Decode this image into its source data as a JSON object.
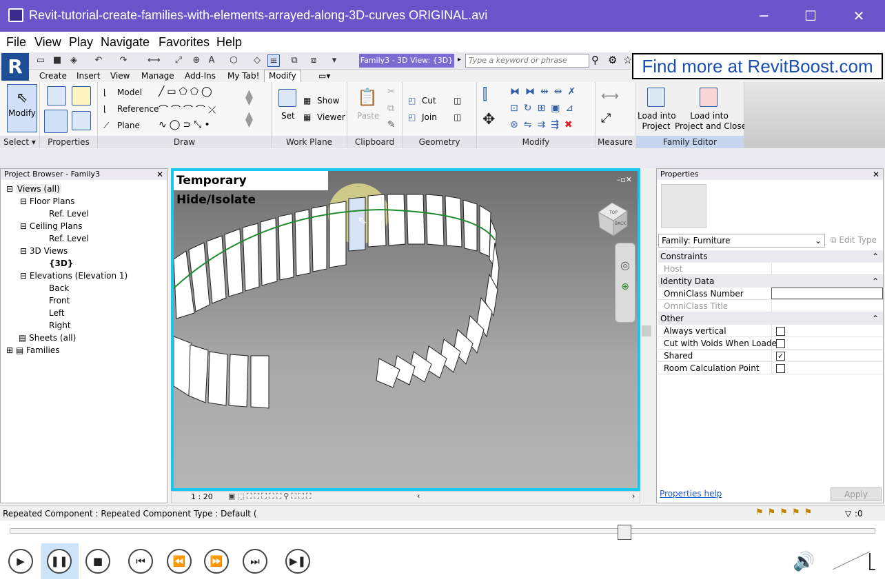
{
  "window": {
    "title": "Revit-tutorial-create-families-with-elements-arrayed-along-3D-curves ORIGINAL.avi",
    "minimize": "─",
    "maximize": "☐",
    "close": "✕"
  },
  "menu": [
    "File",
    "View",
    "Play",
    "Navigate",
    "Favorites",
    "Help"
  ],
  "revit": {
    "doc_title": "Family3 - 3D View: {3D}",
    "search_placeholder": "Type a keyword or phrase",
    "promo": "Find more at RevitBoost.com",
    "tabs": [
      "Create",
      "Insert",
      "View",
      "Manage",
      "Add-Ins",
      "My Tab!",
      "Modify"
    ],
    "active_tab": "Modify",
    "ribbon": {
      "modify_label": "Modify",
      "panels": [
        "Select ▾",
        "Properties",
        "Draw",
        "Work Plane",
        "Clipboard",
        "Geometry",
        "Modify",
        "Measure",
        "Family Editor"
      ],
      "draw_items": [
        "Model",
        "Reference",
        "Plane"
      ],
      "workplane_items": [
        "Set",
        "Show",
        "Viewer"
      ],
      "clipboard_paste": "Paste",
      "geometry_items": [
        "Cut",
        "Join"
      ],
      "family_editor": [
        "Load into\nProject",
        "Load into\nProject and Close"
      ]
    },
    "project_browser": {
      "title": "Project Browser - Family3",
      "items": [
        {
          "label": "Views (all)",
          "level": 0
        },
        {
          "label": "Floor Plans",
          "level": 1
        },
        {
          "label": "Ref. Level",
          "level": 2
        },
        {
          "label": "Ceiling Plans",
          "level": 1
        },
        {
          "label": "Ref. Level",
          "level": 2
        },
        {
          "label": "3D Views",
          "level": 1
        },
        {
          "label": "{3D}",
          "level": 2
        },
        {
          "label": "Elevations (Elevation 1)",
          "level": 1
        },
        {
          "label": "Back",
          "level": 2
        },
        {
          "label": "Front",
          "level": 2
        },
        {
          "label": "Left",
          "level": 2
        },
        {
          "label": "Right",
          "level": 2
        },
        {
          "label": "Sheets (all)",
          "level": 0
        },
        {
          "label": "Families",
          "level": 0
        }
      ]
    },
    "view": {
      "label": "Temporary Hide/Isolate",
      "scale": "1 : 20",
      "viewcube_top": "TOP",
      "viewcube_back": "BACK"
    },
    "properties": {
      "title": "Properties",
      "type_selector": "Family: Furniture",
      "edit_type": "Edit Type",
      "sections": [
        {
          "name": "Constraints",
          "rows": [
            {
              "key": "Host",
              "value": "",
              "greyed": true
            }
          ]
        },
        {
          "name": "Identity Data",
          "rows": [
            {
              "key": "OmniClass Number",
              "value": ""
            },
            {
              "key": "OmniClass Title",
              "value": "",
              "greyed": true
            }
          ]
        },
        {
          "name": "Other",
          "rows": [
            {
              "key": "Always vertical",
              "check": false
            },
            {
              "key": "Cut with Voids When Loaded",
              "check": false
            },
            {
              "key": "Shared",
              "check": true
            },
            {
              "key": "Room Calculation Point",
              "check": false
            }
          ]
        }
      ],
      "help": "Properties help",
      "apply": "Apply"
    },
    "status": {
      "text": "Repeated Component : Repeated Component Type : Default (",
      "filter_count": ":0"
    }
  },
  "player": {
    "progress": 0.71,
    "buttons": [
      "▶",
      "❚❚",
      "■",
      "⏮",
      "⏪",
      "⏩",
      "⏭",
      "▶❚"
    ]
  }
}
